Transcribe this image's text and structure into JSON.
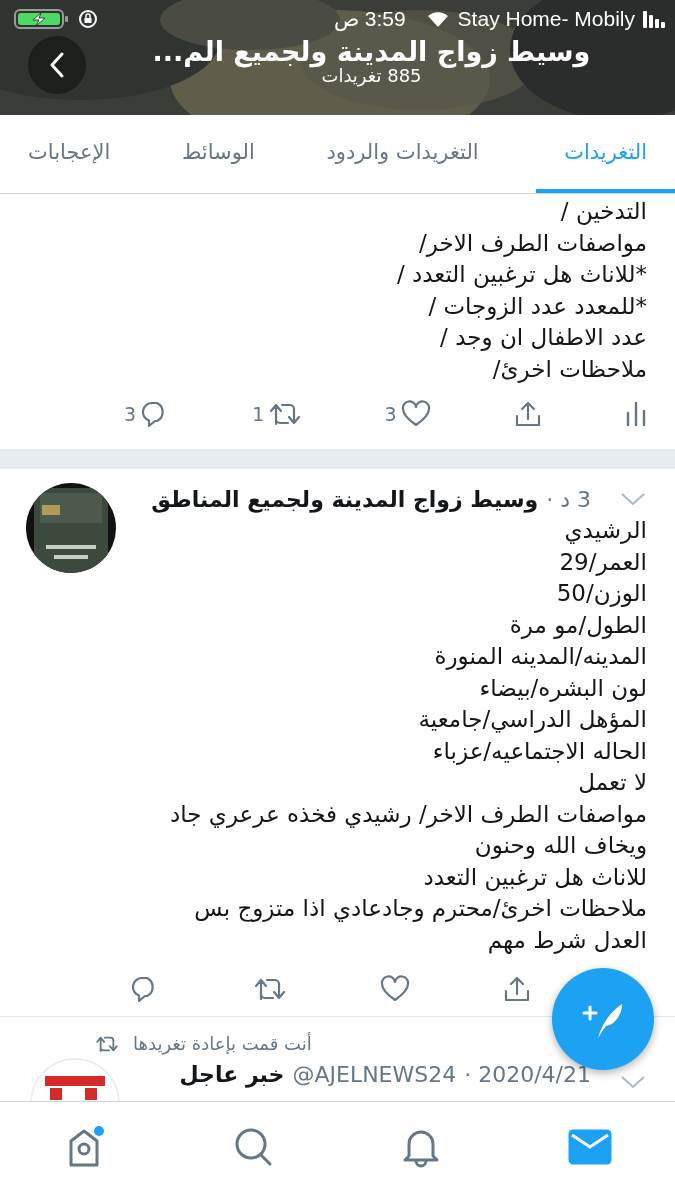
{
  "status_bar": {
    "time": "3:59",
    "ampm": "ص",
    "carrier": "Stay Home- Mobily"
  },
  "header": {
    "title": "وسيط زواج المدينة ولجميع الم...",
    "subtitle": "885 تغريدات"
  },
  "tabs": [
    {
      "label": "التغريدات",
      "selected": true
    },
    {
      "label": "التغريدات والردود",
      "selected": false
    },
    {
      "label": "الوسائط",
      "selected": false
    },
    {
      "label": "الإعجابات",
      "selected": false
    }
  ],
  "tweets": [
    {
      "kind": "continued",
      "text": "التدخين /\nمواصفات الطرف الاخر/\n*للاناث هل ترغبين التعدد /\n*للمعدد عدد الزوجات /\nعدد الاطفال ان وجد /\nملاحظات اخرئ/",
      "replies": "3",
      "retweets": "1",
      "likes": "3"
    },
    {
      "kind": "full",
      "name": "وسيط زواج المدينة ولجميع المناطق",
      "time": "3 د ·",
      "text": "الرشيدي\nالعمر/29\nالوزن/50\nالطول/مو مرة\nالمدينه/المدينه المنورة\nلون البشره/بيضاء\nالمؤهل الدراسي/جامعية\nالحاله الاجتماعيه/عزباء\nلا تعمل\nمواصفات الطرف الاخر/ رشيدي فخذه عرعري جاد\nويخاف الله وحنون\nللاناث هل ترغبين التعدد\nملاحظات اخرئ/محترم وجادعادي اذا متزوج  بس\nالعدل شرط مهم"
    },
    {
      "kind": "retweeted",
      "context": "أنت قمت بإعادة تغريدها",
      "name": "خبر عاجل",
      "handle": "@AJELNEWS24",
      "time": "· 2020/4/21"
    }
  ],
  "nav": [
    {
      "selected": false,
      "has_new": true
    },
    {
      "selected": false
    },
    {
      "selected": false
    },
    {
      "selected": true
    }
  ]
}
